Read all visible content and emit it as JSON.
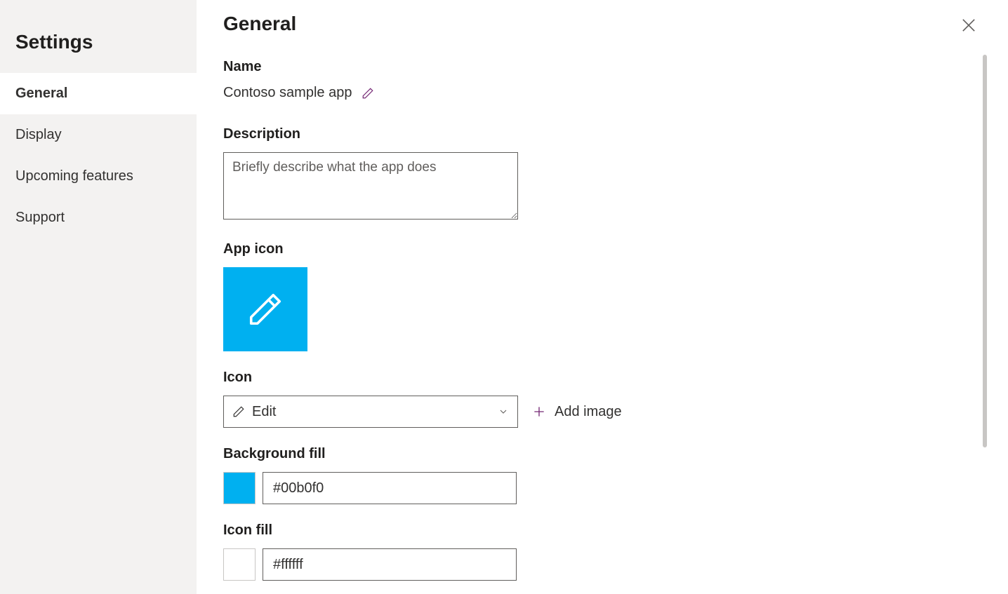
{
  "sidebar": {
    "title": "Settings",
    "items": [
      {
        "label": "General",
        "active": true
      },
      {
        "label": "Display",
        "active": false
      },
      {
        "label": "Upcoming features",
        "active": false
      },
      {
        "label": "Support",
        "active": false
      }
    ]
  },
  "page": {
    "title": "General"
  },
  "general": {
    "name_label": "Name",
    "name_value": "Contoso sample app",
    "description_label": "Description",
    "description_placeholder": "Briefly describe what the app does",
    "description_value": "",
    "app_icon_label": "App icon",
    "icon_label": "Icon",
    "icon_selected": "Edit",
    "add_image_label": "Add image",
    "background_fill_label": "Background fill",
    "background_fill_value": "#00b0f0",
    "icon_fill_label": "Icon fill",
    "icon_fill_value": "#ffffff"
  },
  "colors": {
    "accent_tile": "#00b0f0",
    "icon_purple": "#742774"
  }
}
